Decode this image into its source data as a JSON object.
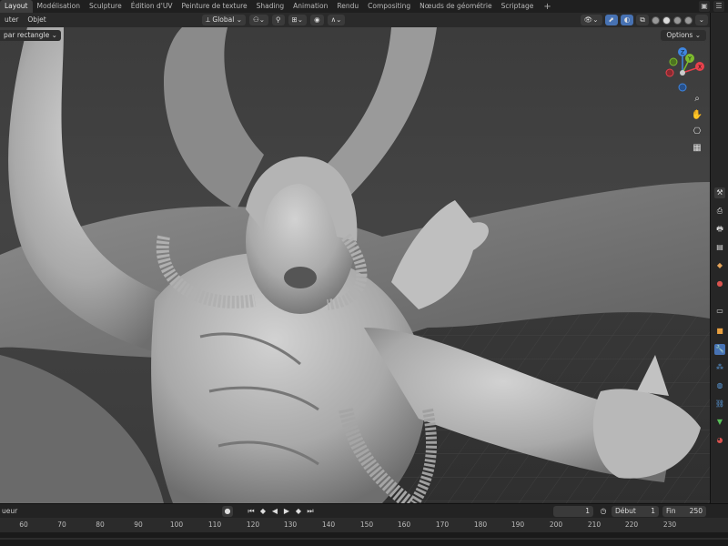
{
  "workspace_tabs": [
    "Layout",
    "Modélisation",
    "Sculpture",
    "Édition d'UV",
    "Peinture de texture",
    "Shading",
    "Animation",
    "Rendu",
    "Compositing",
    "Nœuds de géométrie",
    "Scriptage"
  ],
  "active_tab": "Layout",
  "add_tab": "+",
  "header": {
    "menu_view": "uter",
    "menu_object": "Objet",
    "transform_orientation": "Global",
    "select_mode": "par rectangle",
    "options": "Options"
  },
  "gizmo": {
    "z": "Z",
    "y": "Y",
    "x": "X"
  },
  "timeline": {
    "marker_label": "ueur",
    "current_frame": "1",
    "start_label": "Début",
    "start_value": "1",
    "end_label": "Fin",
    "end_value": "250",
    "ruler": [
      "60",
      "70",
      "80",
      "90",
      "100",
      "110",
      "120",
      "130",
      "140",
      "150",
      "160",
      "170",
      "180",
      "190",
      "200",
      "210",
      "220",
      "230"
    ]
  },
  "colors": {
    "accent": "#4772b3",
    "gizmo_x": "#e8414c",
    "gizmo_y": "#7dbb2e",
    "gizmo_z": "#3f86e0"
  }
}
